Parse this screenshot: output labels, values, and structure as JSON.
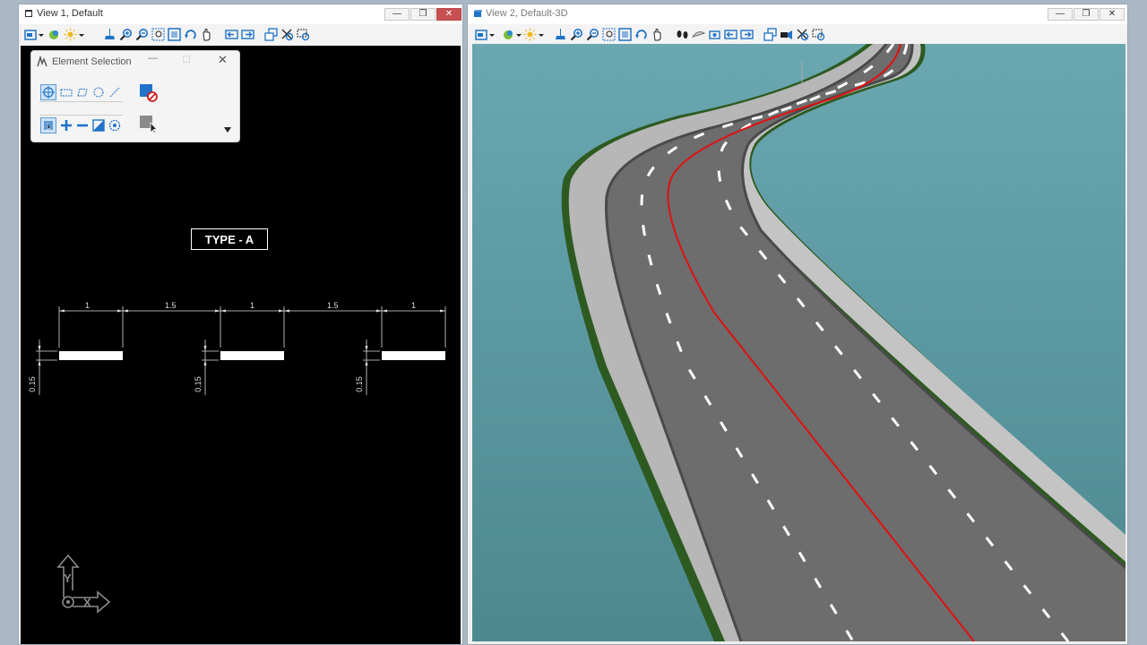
{
  "view1": {
    "title": "View 1, Default",
    "selection_panel": {
      "title": "Element Selection"
    },
    "drawing": {
      "type_label": "TYPE - A",
      "dimensions_top": [
        "1",
        "1.5",
        "1",
        "1.5",
        "1"
      ],
      "dimension_side": "0.15"
    }
  },
  "view2": {
    "title": "View 2, Default-3D"
  },
  "window_controls": {
    "minimize": "—",
    "restore": "❐",
    "close": "✕"
  },
  "colors": {
    "accent": "#1f73c8",
    "close": "#c75050",
    "sky": "#5f9aa3",
    "road": "#6b6b6b",
    "grass": "#2e5a22",
    "centerline": "#e01010"
  }
}
